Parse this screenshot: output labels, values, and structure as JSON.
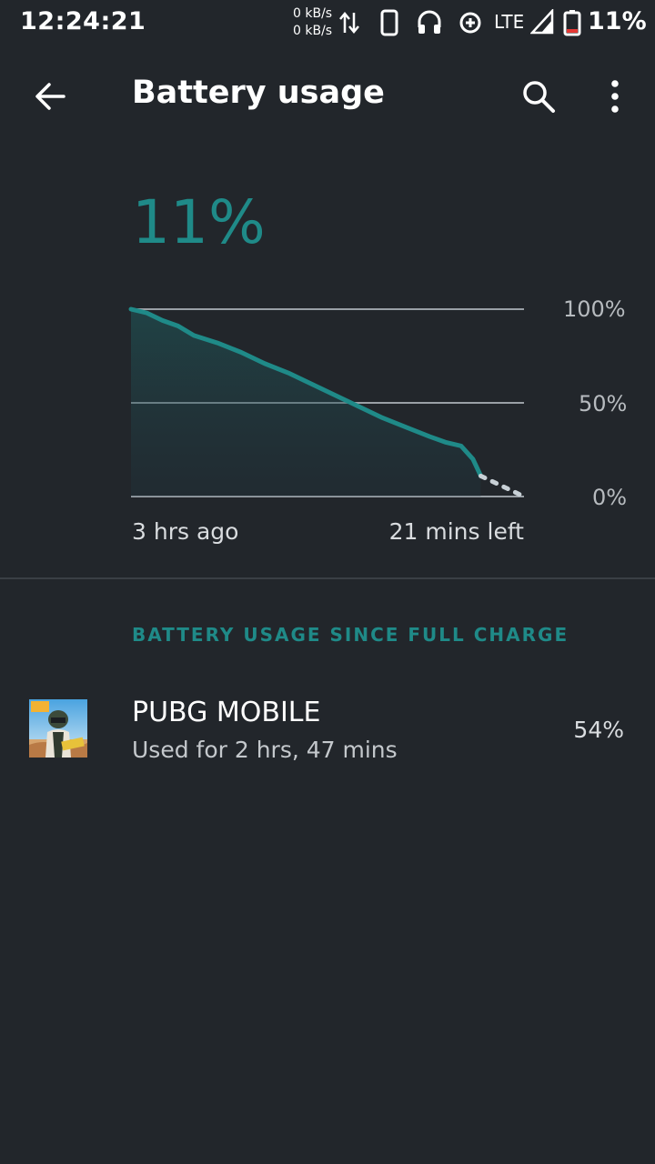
{
  "status_bar": {
    "time": "12:24:21",
    "speed_up": "0 kB/s",
    "speed_down": "0 kB/s",
    "network": "LTE",
    "battery_percent": "11%",
    "icons": [
      "data-transfer-icon",
      "phone-icon",
      "headphones-icon",
      "data-saver-icon",
      "signal-icon",
      "battery-icon"
    ]
  },
  "app_bar": {
    "title": "Battery usage",
    "icons": [
      "back-arrow-icon",
      "search-icon",
      "more-vert-icon"
    ]
  },
  "battery": {
    "current_level": "11%"
  },
  "chart_data": {
    "type": "area",
    "y_tick_labels": [
      "100%",
      "50%",
      "0%"
    ],
    "ylim": [
      0,
      100
    ],
    "x_labels": [
      "3 hrs ago",
      "21 mins left"
    ],
    "grid": true,
    "accent_color": "#1f8a88",
    "series": [
      {
        "x": [
          0,
          0.04,
          0.08,
          0.12,
          0.16,
          0.22,
          0.28,
          0.34,
          0.4,
          0.46,
          0.52,
          0.58,
          0.64,
          0.7,
          0.76,
          0.8,
          0.84,
          0.87,
          0.89
        ],
        "values": [
          100,
          98,
          94,
          91,
          86,
          82,
          77,
          71,
          66,
          60,
          54,
          48,
          42,
          37,
          32,
          29,
          27,
          20,
          11
        ]
      },
      {
        "projected": true,
        "x": [
          0.89,
          0.94,
          1.0
        ],
        "values": [
          11,
          6,
          0
        ]
      }
    ]
  },
  "section": {
    "header": "BATTERY USAGE SINCE FULL CHARGE"
  },
  "apps": [
    {
      "name": "PUBG MOBILE",
      "used": "Used for 2 hrs, 47 mins",
      "percent": "54%"
    }
  ]
}
